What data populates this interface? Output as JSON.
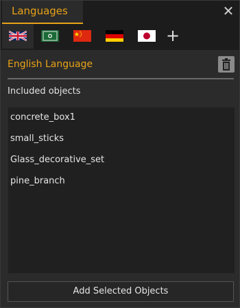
{
  "window": {
    "title": "Languages",
    "close_icon": "close-icon"
  },
  "flags": [
    {
      "name": "uk-flag-icon",
      "active": true
    },
    {
      "name": "arabic-flag-icon"
    },
    {
      "name": "china-flag-icon"
    },
    {
      "name": "germany-flag-icon"
    },
    {
      "name": "japan-flag-icon"
    }
  ],
  "add_language_label": "+",
  "language": {
    "name": "English Language",
    "delete_icon": "trash-icon"
  },
  "included_objects_label": "Included objects",
  "objects": [
    "concrete_box1",
    "small_sticks",
    "Glass_decorative_set",
    "pine_branch"
  ],
  "add_button_label": "Add Selected Objects",
  "colors": {
    "accent": "#e8a317",
    "background": "#2b2b2b",
    "header": "#1c1c1c",
    "list_bg": "#202020"
  }
}
